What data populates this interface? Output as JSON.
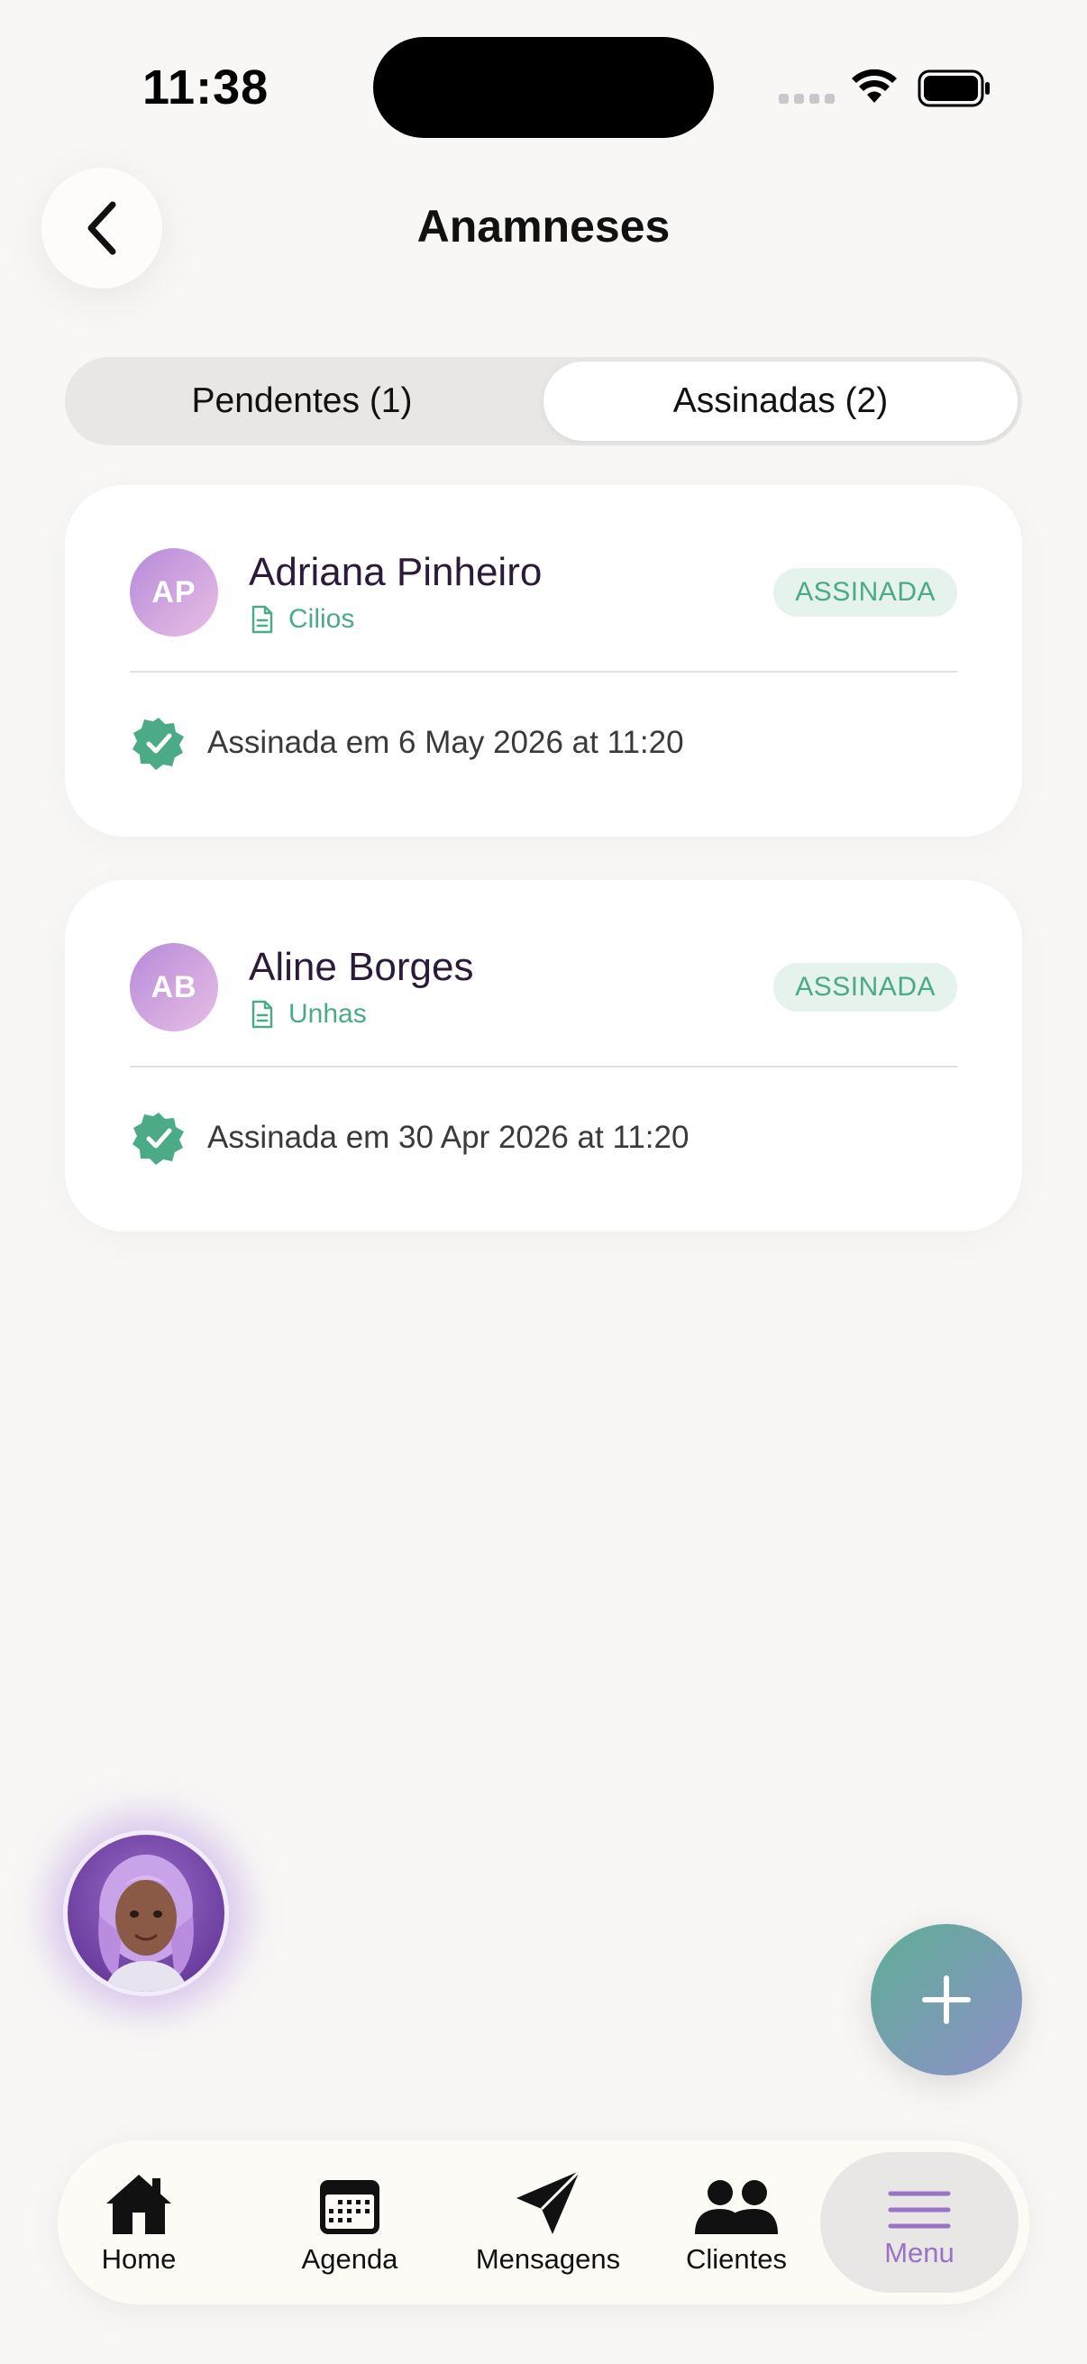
{
  "status_bar": {
    "time": "11:38"
  },
  "header": {
    "title": "Anamneses"
  },
  "segmented": {
    "tabs": [
      {
        "label": "Pendentes (1)",
        "active": false
      },
      {
        "label": "Assinadas (2)",
        "active": true
      }
    ]
  },
  "cards": [
    {
      "initials": "AP",
      "name": "Adriana Pinheiro",
      "service": "Cilios",
      "status": "ASSINADA",
      "signed_text": "Assinada em 6 May 2026 at 11:20"
    },
    {
      "initials": "AB",
      "name": "Aline Borges",
      "service": "Unhas",
      "status": "ASSINADA",
      "signed_text": "Assinada em 30 Apr 2026 at 11:20"
    }
  ],
  "tabbar": {
    "items": [
      {
        "label": "Home",
        "icon": "home-icon"
      },
      {
        "label": "Agenda",
        "icon": "calendar-icon"
      },
      {
        "label": "Mensagens",
        "icon": "send-icon"
      },
      {
        "label": "Clientes",
        "icon": "people-icon"
      },
      {
        "label": "Menu",
        "icon": "menu-icon",
        "active": true
      }
    ]
  },
  "colors": {
    "accent_green": "#4aab86",
    "accent_purple": "#9a72c6",
    "background": "#f8f7f5"
  }
}
